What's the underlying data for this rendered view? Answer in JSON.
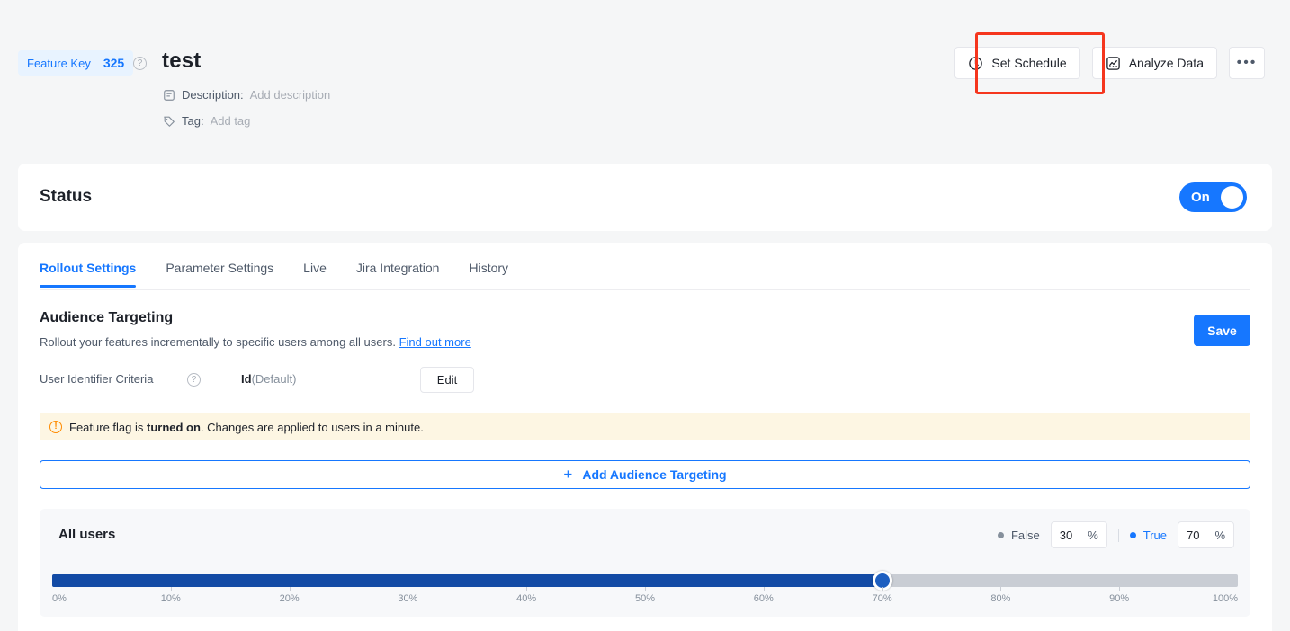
{
  "header": {
    "feature_key_label": "Feature Key",
    "feature_key_value": "325",
    "help_icon": "question-circle-icon",
    "title": "test",
    "description_label": "Description:",
    "description_placeholder": "Add description",
    "tag_label": "Tag:",
    "tag_placeholder": "Add tag",
    "actions": {
      "set_schedule": "Set Schedule",
      "set_schedule_icon": "clock-icon",
      "analyze_data": "Analyze Data",
      "analyze_data_icon": "chart-box-icon",
      "more": "•••"
    },
    "highlight_color": "#f5361e"
  },
  "status": {
    "title": "Status",
    "toggle_label": "On",
    "toggle_on": true,
    "accent": "#1677ff"
  },
  "tabs": [
    {
      "label": "Rollout Settings",
      "active": true
    },
    {
      "label": "Parameter Settings",
      "active": false
    },
    {
      "label": "Live",
      "active": false
    },
    {
      "label": "Jira Integration",
      "active": false
    },
    {
      "label": "History",
      "active": false
    }
  ],
  "audience": {
    "title": "Audience Targeting",
    "subtitle": "Rollout your features incrementally to specific users among all users.",
    "link": "Find out more",
    "save_label": "Save",
    "criteria_label": "User Identifier Criteria",
    "criteria_help_icon": "question-circle-icon",
    "criteria_value_bold": "Id",
    "criteria_value_muted": "(Default)",
    "edit_label": "Edit",
    "warning_icon": "exclamation-circle-icon",
    "warning_prefix": "Feature flag is ",
    "warning_bold": "turned on",
    "warning_suffix": ". Changes are applied to users in a minute.",
    "add_label": "Add Audience Targeting",
    "add_icon": "plus-icon"
  },
  "all_users": {
    "title": "All users",
    "false_label": "False",
    "false_value": "30",
    "true_label": "True",
    "true_value": "70",
    "percent_symbol": "%",
    "slider_value": 70,
    "ticks": [
      "0%",
      "10%",
      "20%",
      "30%",
      "40%",
      "50%",
      "60%",
      "70%",
      "80%",
      "90%",
      "100%"
    ],
    "fill_color": "#134ba5",
    "track_color": "#c9cdd4"
  }
}
